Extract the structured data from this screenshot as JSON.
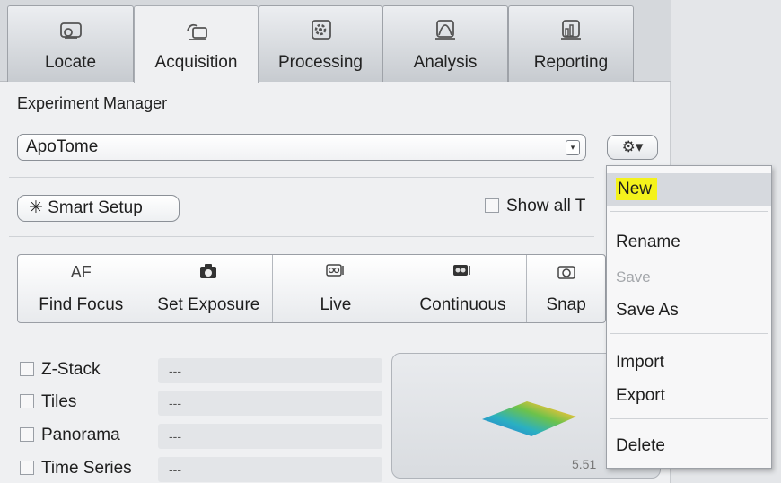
{
  "tabs": [
    {
      "label": "Locate",
      "icon": "locate-icon"
    },
    {
      "label": "Acquisition",
      "icon": "acquisition-icon"
    },
    {
      "label": "Processing",
      "icon": "processing-icon"
    },
    {
      "label": "Analysis",
      "icon": "analysis-icon"
    },
    {
      "label": "Reporting",
      "icon": "reporting-icon"
    }
  ],
  "active_tab": "Acquisition",
  "experiment_manager": {
    "label": "Experiment Manager",
    "selected_experiment": "ApoTome",
    "dropdown_arrow": "▾",
    "gear_button": "⚙▾"
  },
  "smart_setup": {
    "label": "Smart Setup",
    "icon": "sparkle-icon",
    "icon_glyph": "✳"
  },
  "show_all": {
    "label": "Show all T",
    "checked": false
  },
  "acquisition_buttons": [
    {
      "top": "AF",
      "label": "Find Focus",
      "icon": "af-text"
    },
    {
      "top": "",
      "label": "Set Exposure",
      "icon": "camera-icon"
    },
    {
      "top": "",
      "label": "Live",
      "icon": "live-camera-icon"
    },
    {
      "top": "",
      "label": "Continuous",
      "icon": "continuous-camera-icon"
    },
    {
      "top": "",
      "label": "Snap",
      "icon": "snap-camera-icon"
    }
  ],
  "experiment_options": [
    {
      "label": "Z-Stack",
      "value": "---",
      "checked": false
    },
    {
      "label": "Tiles",
      "value": "---",
      "checked": false
    },
    {
      "label": "Panorama",
      "value": "---",
      "checked": false
    },
    {
      "label": "Time Series",
      "value": "---",
      "checked": false
    }
  ],
  "preview_value": "5.51",
  "context_menu": {
    "items": [
      {
        "label": "New",
        "highlighted": true,
        "enabled": true
      },
      {
        "label": "Rename",
        "enabled": true
      },
      {
        "label": "Save",
        "enabled": false
      },
      {
        "label": "Save As",
        "enabled": true
      },
      {
        "label": "Import",
        "enabled": true
      },
      {
        "label": "Export",
        "enabled": true
      },
      {
        "label": "Delete",
        "enabled": true
      }
    ]
  },
  "colors": {
    "highlight_yellow": "#f4f21c",
    "panel_bg": "#eff0f2",
    "tab_bg": "#c7cbd0"
  }
}
